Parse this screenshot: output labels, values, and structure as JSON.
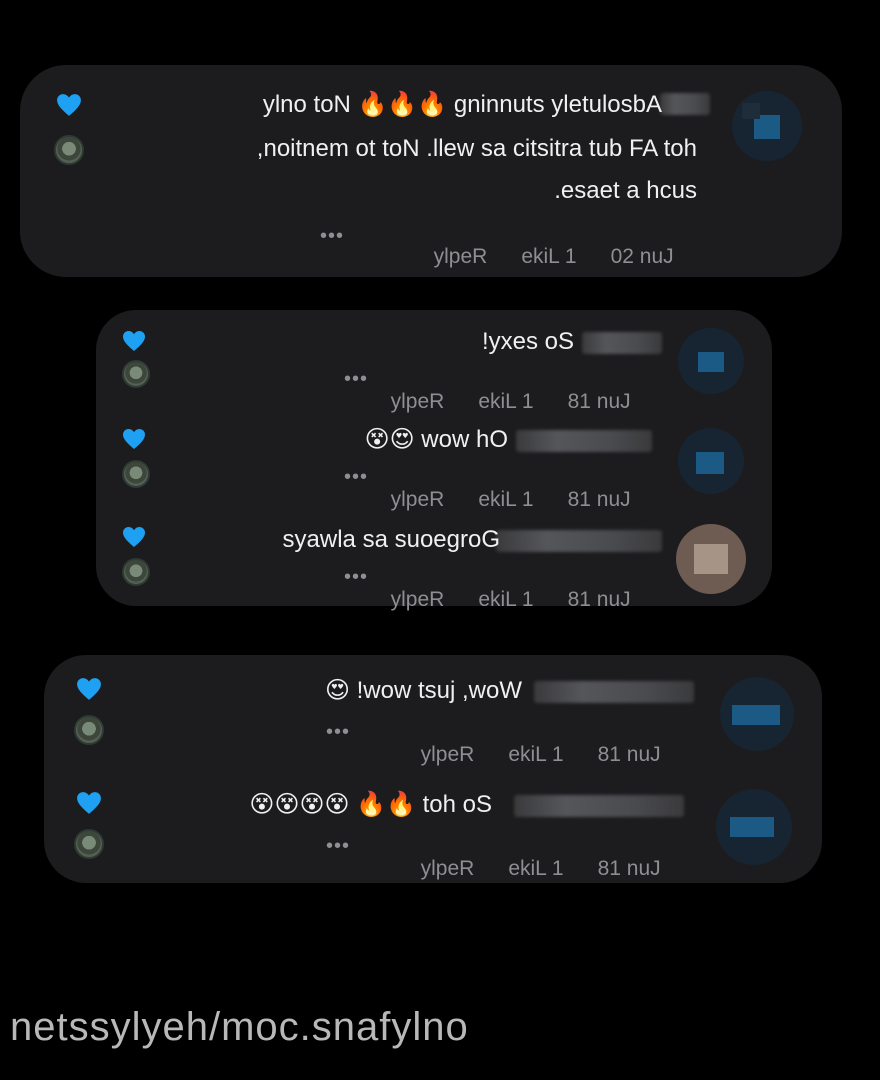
{
  "accent_heart": "#1ea1f2",
  "comments": [
    {
      "id": "c1",
      "text_lines": [
        "Absolutely stunning 🔥🔥🔥 Not only",
        "hot AF but artistic as well. Not to mention,",
        "such a tease."
      ],
      "date": "Jun 20",
      "likes": "1 Like",
      "reply": "Reply",
      "more": "•••"
    },
    {
      "id": "r1",
      "text": "So sexy!",
      "date": "Jun 18",
      "likes": "1 Like",
      "reply": "Reply",
      "more": "•••"
    },
    {
      "id": "r2",
      "text": "Oh wow 😍😵",
      "date": "Jun 18",
      "likes": "1 Like",
      "reply": "Reply",
      "more": "•••"
    },
    {
      "id": "r3",
      "text": "Gorgeous as always",
      "date": "Jun 18",
      "likes": "1 Like",
      "reply": "Reply",
      "more": "•••"
    },
    {
      "id": "c2",
      "text": "Wow, just wow! 😍",
      "date": "Jun 18",
      "likes": "1 Like",
      "reply": "Reply",
      "more": "•••"
    },
    {
      "id": "c3",
      "text": "So hot 🔥🔥 😵😵😵😵",
      "date": "Jun 18",
      "likes": "1 Like",
      "reply": "Reply",
      "more": "•••"
    }
  ],
  "watermark": "onlyfans.com/heylyssten"
}
